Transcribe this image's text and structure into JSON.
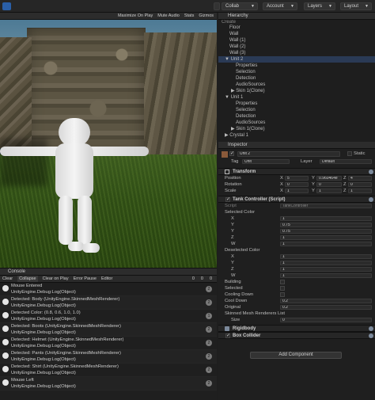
{
  "toolbar": {
    "collab_label": "Collab",
    "account_label": "Account",
    "layers_label": "Layers",
    "layout_label": "Layout"
  },
  "game_view": {
    "options": [
      "Maximize On Play",
      "Mute Audio",
      "Stats",
      "Gizmos"
    ]
  },
  "console": {
    "tab": "Console",
    "buttons": [
      "Clear",
      "Collapse",
      "Clear on Play",
      "Error Pause",
      "Editor"
    ],
    "counts": [
      "0",
      "0",
      "0"
    ],
    "logs": [
      {
        "line1": "Mouse Entered",
        "line2": "UnityEngine.Debug:Log(Object)",
        "count": "2"
      },
      {
        "line1": "Detected: Body (UnityEngine.SkinnedMeshRenderer)",
        "line2": "UnityEngine.Debug:Log(Object)",
        "count": "2"
      },
      {
        "line1": "Detected Color: (0.8, 0.6, 1.0, 1.0)",
        "line2": "UnityEngine.Debug:Log(Object)",
        "count": "1"
      },
      {
        "line1": "Detected: Boots (UnityEngine.SkinnedMeshRenderer)",
        "line2": "UnityEngine.Debug:Log(Object)",
        "count": "2"
      },
      {
        "line1": "Detected: Helmet (UnityEngine.SkinnedMeshRenderer)",
        "line2": "UnityEngine.Debug:Log(Object)",
        "count": "2"
      },
      {
        "line1": "Detected: Pants (UnityEngine.SkinnedMeshRenderer)",
        "line2": "UnityEngine.Debug:Log(Object)",
        "count": "2"
      },
      {
        "line1": "Detected: Shirt (UnityEngine.SkinnedMeshRenderer)",
        "line2": "UnityEngine.Debug:Log(Object)",
        "count": "2"
      },
      {
        "line1": "Mouse Left",
        "line2": "UnityEngine.Debug:Log(Object)",
        "count": "2"
      }
    ]
  },
  "hierarchy": {
    "tab": "Hierarchy",
    "create_label": "Create",
    "rows": [
      {
        "label": "Floor",
        "indent": 1
      },
      {
        "label": "Wall",
        "indent": 1
      },
      {
        "label": "Wall (1)",
        "indent": 1
      },
      {
        "label": "Wall (2)",
        "indent": 1
      },
      {
        "label": "Wall (3)",
        "indent": 1
      },
      {
        "label": "▼ Unit 2",
        "indent": 1,
        "selected": true
      },
      {
        "label": "Properties",
        "indent": 2
      },
      {
        "label": "Selection",
        "indent": 2
      },
      {
        "label": "Detection",
        "indent": 2
      },
      {
        "label": "AudioSources",
        "indent": 2
      },
      {
        "label": "▶ Skin 1(Clone)",
        "indent": 2
      },
      {
        "label": "▼ Unit 1",
        "indent": 1
      },
      {
        "label": "Properties",
        "indent": 2
      },
      {
        "label": "Selection",
        "indent": 2
      },
      {
        "label": "Detection",
        "indent": 2
      },
      {
        "label": "AudioSources",
        "indent": 2
      },
      {
        "label": "▶ Skin 1(Clone)",
        "indent": 2
      },
      {
        "label": "▶ Crystal 1",
        "indent": 1
      }
    ]
  },
  "inspector": {
    "tab": "Inspector",
    "object_name": "Unit 2",
    "static_label": "Static",
    "tag_label": "Tag",
    "tag_value": "Unit",
    "layer_label": "Layer",
    "layer_value": "Default",
    "transform": {
      "title": "Transform",
      "rows": [
        {
          "label": "Position",
          "x": "5",
          "y": "0.960464e",
          "z": "4"
        },
        {
          "label": "Rotation",
          "x": "0",
          "y": "0",
          "z": "0"
        },
        {
          "label": "Scale",
          "x": "1",
          "y": "1",
          "z": "1"
        }
      ]
    },
    "tank": {
      "title": "Tank Controller (Script)",
      "script_label": "Script",
      "script_value": "TankController",
      "selected_color_label": "Selected Color",
      "selected_color": [
        {
          "k": "X",
          "v": "1"
        },
        {
          "k": "Y",
          "v": "0.75"
        },
        {
          "k": "Y",
          "v": "0.75"
        },
        {
          "k": "Z",
          "v": "1"
        },
        {
          "k": "W",
          "v": "1"
        }
      ],
      "deselected_color_label": "Deselected Color",
      "deselected_color": [
        {
          "k": "X",
          "v": "1"
        },
        {
          "k": "Y",
          "v": "1"
        },
        {
          "k": "Z",
          "v": "1"
        },
        {
          "k": "W",
          "v": "1"
        }
      ],
      "bools": [
        "Building",
        "Selected",
        "Cooling Down"
      ],
      "cool_down_label": "Cool Down",
      "cool_down_value": "0.2",
      "original_label": "Original",
      "original_value": "0.2",
      "skinned_label": "Skinned Mesh Renderers List",
      "size_label": "Size",
      "size_value": "0"
    },
    "rigidbody_title": "Rigidbody",
    "box_collider_title": "Box Collider",
    "add_component_label": "Add Component"
  },
  "colors": {
    "accent": "#2a5fa8",
    "selection": "#2a3a55"
  }
}
